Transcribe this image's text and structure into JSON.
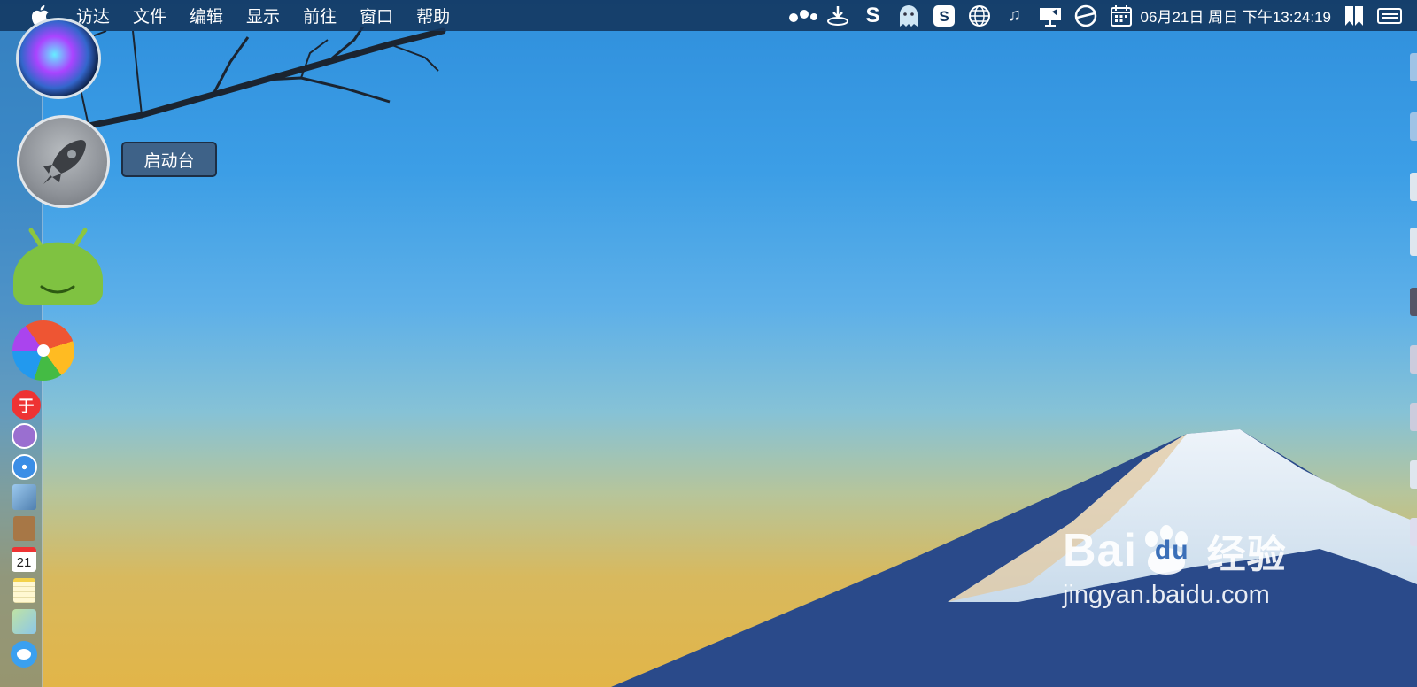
{
  "menubar": {
    "apple_icon": "apple-logo",
    "items": [
      "访达",
      "文件",
      "编辑",
      "显示",
      "前往",
      "窗口",
      "帮助"
    ],
    "status_icons": [
      "more-dots-icon",
      "download-tray-icon",
      "s-app-icon",
      "ghost-icon",
      "sogou-icon",
      "globe-icon",
      "music-note-icon",
      "display-icon",
      "steering-wheel-icon",
      "calendar-icon"
    ],
    "clock": "06月21日 周日 下午13:24:19",
    "right_icons": [
      "bookmark-icon",
      "control-center-icon"
    ]
  },
  "dock": {
    "items": [
      "siri",
      "launchpad",
      "android-file-transfer",
      "pinwheel-app",
      "red-app",
      "purple-app",
      "safari",
      "preview",
      "contacts",
      "calendar",
      "notes",
      "maps",
      "messages"
    ],
    "calendar_day": "21",
    "tooltip": "启动台"
  },
  "watermark": {
    "logo_text_a": "Bai",
    "logo_text_b": "du",
    "logo_text_c": "经验",
    "url": "jingyan.baidu.com"
  },
  "colors": {
    "menubar": "#12345c",
    "tooltip": "#3e6288"
  }
}
